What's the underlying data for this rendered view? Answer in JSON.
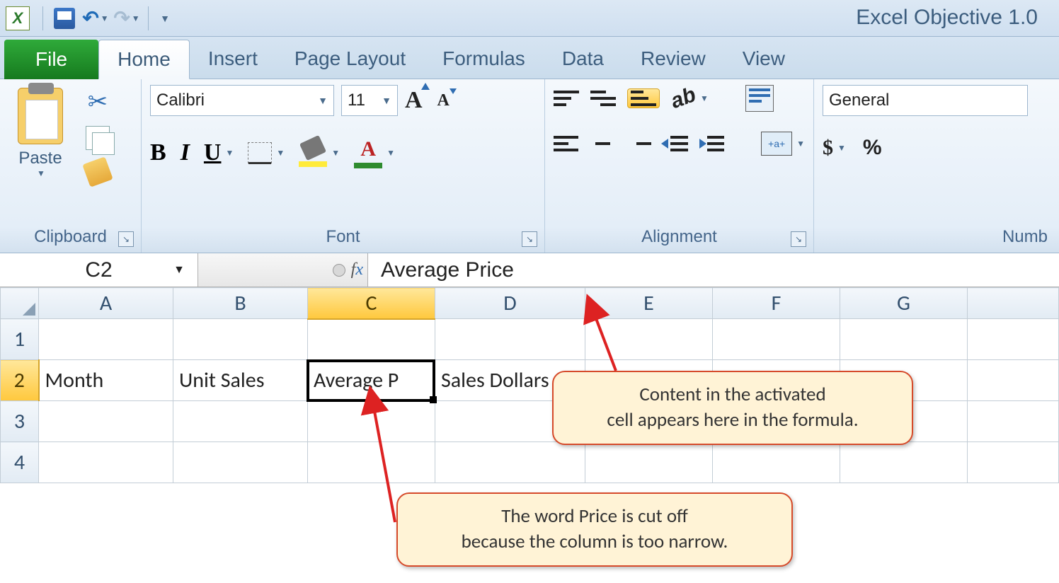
{
  "title": "Excel Objective 1.0",
  "tabs": {
    "file": "File",
    "home": "Home",
    "insert": "Insert",
    "pageLayout": "Page Layout",
    "formulas": "Formulas",
    "data": "Data",
    "review": "Review",
    "view": "View"
  },
  "ribbon": {
    "clipboard": {
      "label": "Clipboard",
      "paste": "Paste"
    },
    "font": {
      "label": "Font",
      "name": "Calibri",
      "size": "11",
      "bold": "B",
      "italic": "I",
      "underline": "U",
      "growA": "A",
      "shrinkA": "A",
      "fontColorA": "A"
    },
    "alignment": {
      "label": "Alignment",
      "mergeText": "+a+"
    },
    "number": {
      "label": "Numb",
      "format": "General",
      "dollar": "$",
      "percent": "%"
    }
  },
  "formulaBar": {
    "nameBox": "C2",
    "fx": "fx",
    "content": "Average Price"
  },
  "columns": [
    "A",
    "B",
    "C",
    "D",
    "E",
    "F",
    "G"
  ],
  "rows": [
    "1",
    "2",
    "3",
    "4"
  ],
  "cells": {
    "A2": "Month",
    "B2": "Unit Sales",
    "C2": "Average Price",
    "C2_display": "Average P",
    "D2": "Sales Dollars"
  },
  "callouts": {
    "c1_line1": "Content in the activated",
    "c1_line2": "cell appears here in the formula.",
    "c2_line1": "The word Price is cut off",
    "c2_line2": "because the column is too narrow."
  }
}
